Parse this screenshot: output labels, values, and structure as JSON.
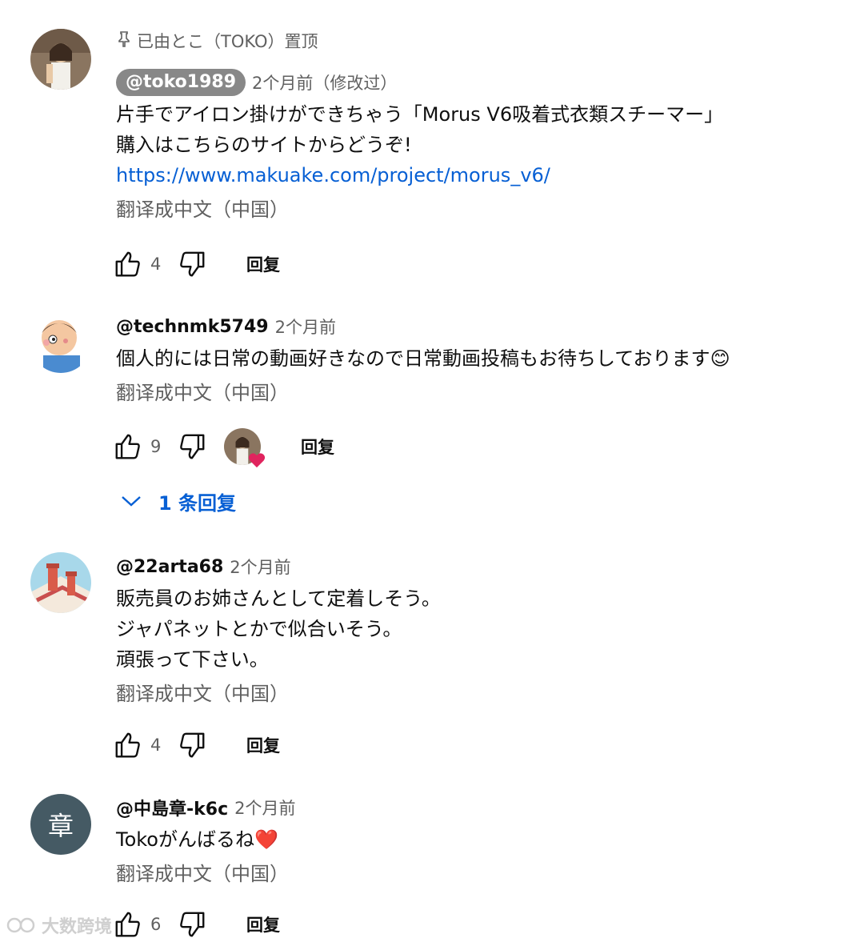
{
  "comments": [
    {
      "pinned_text": "已由とこ（TOKO）置顶",
      "author": "@toko1989",
      "time": "2个月前（修改过）",
      "lines": [
        "片手でアイロン掛けができちゃう「Morus V6吸着式衣類スチーマー」",
        "購入はこちらのサイトからどうぞ!"
      ],
      "link": "https://www.makuake.com/project/morus_v6/",
      "translate": "翻译成中文（中国）",
      "likes": "4",
      "reply_label": "回复"
    },
    {
      "author": "@technmk5749",
      "time": "2个月前",
      "lines": [
        "個人的には日常の動画好きなので日常動画投稿もお待ちしております"
      ],
      "emoji": "😊",
      "translate": "翻译成中文（中国）",
      "likes": "9",
      "reply_label": "回复",
      "replies_label": "1 条回复"
    },
    {
      "author": "@22arta68",
      "time": "2个月前",
      "lines": [
        "販売員のお姉さんとして定着しそう。",
        "ジャパネットとかで似合いそう。",
        "頑張って下さい。"
      ],
      "translate": "翻译成中文（中国）",
      "likes": "4",
      "reply_label": "回复"
    },
    {
      "author": "@中島章-k6c",
      "time": "2个月前",
      "avatar_letter": "章",
      "lines": [
        "Tokoがんばるね"
      ],
      "emoji": "❤️",
      "translate": "翻译成中文（中国）",
      "likes": "6",
      "reply_label": "回复"
    }
  ],
  "watermark": "大数跨境",
  "colors": {
    "link": "#065fd4",
    "secondary": "#606060",
    "heart": "#e0245e",
    "avatar_gray": "#455a64"
  }
}
